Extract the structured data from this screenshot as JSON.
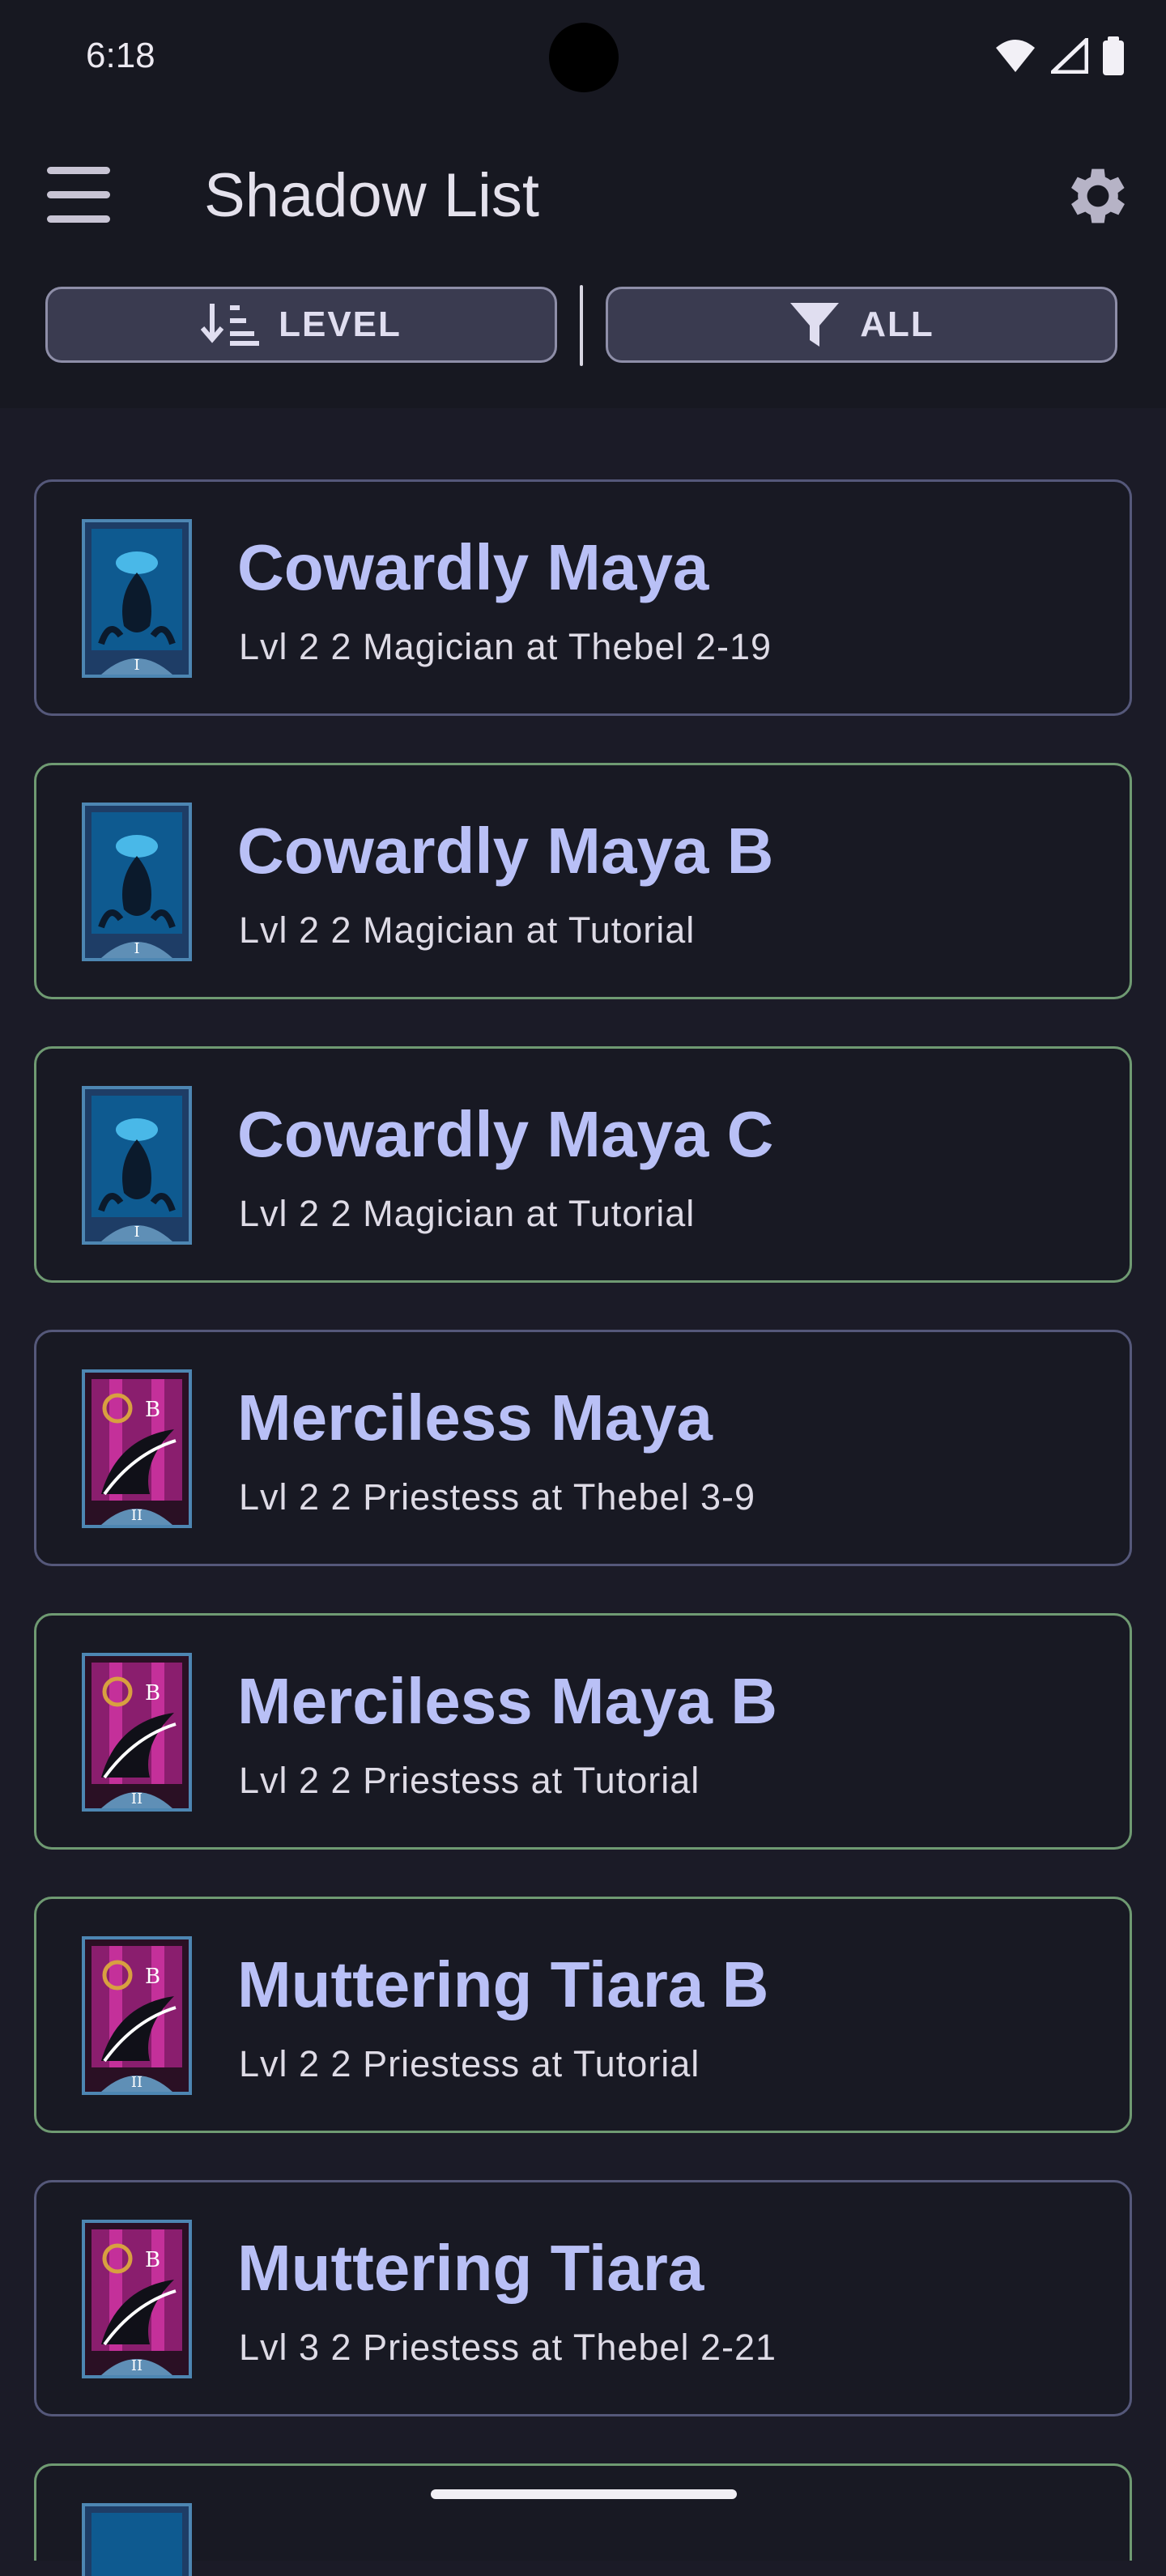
{
  "status": {
    "time": "6:18"
  },
  "header": {
    "title": "Shadow List"
  },
  "filters": {
    "sort_label": "LEVEL",
    "filter_label": "ALL"
  },
  "shadows": [
    {
      "name": "Cowardly Maya",
      "details": "Lvl 2 2 Magician at Thebel 2-19",
      "arcana_icon": "magician-tarot-icon",
      "numeral": "I"
    },
    {
      "name": "Cowardly Maya B",
      "details": "Lvl 2 2 Magician at Tutorial",
      "arcana_icon": "magician-tarot-icon",
      "numeral": "I"
    },
    {
      "name": "Cowardly Maya C",
      "details": "Lvl 2 2 Magician at Tutorial",
      "arcana_icon": "magician-tarot-icon",
      "numeral": "I"
    },
    {
      "name": "Merciless Maya",
      "details": "Lvl 2 2 Priestess at Thebel 3-9",
      "arcana_icon": "priestess-tarot-icon",
      "numeral": "II"
    },
    {
      "name": "Merciless Maya B",
      "details": "Lvl 2 2 Priestess at Tutorial",
      "arcana_icon": "priestess-tarot-icon",
      "numeral": "II"
    },
    {
      "name": "Muttering Tiara B",
      "details": "Lvl 2 2 Priestess at Tutorial",
      "arcana_icon": "priestess-tarot-icon",
      "numeral": "II"
    },
    {
      "name": "Muttering Tiara",
      "details": "Lvl 3 2 Priestess at Thebel 2-21",
      "arcana_icon": "priestess-tarot-icon",
      "numeral": "II"
    }
  ],
  "colors": {
    "accent_text": "#b9c0f6",
    "green_border": "#6f9a72",
    "plain_border": "#55587a"
  }
}
